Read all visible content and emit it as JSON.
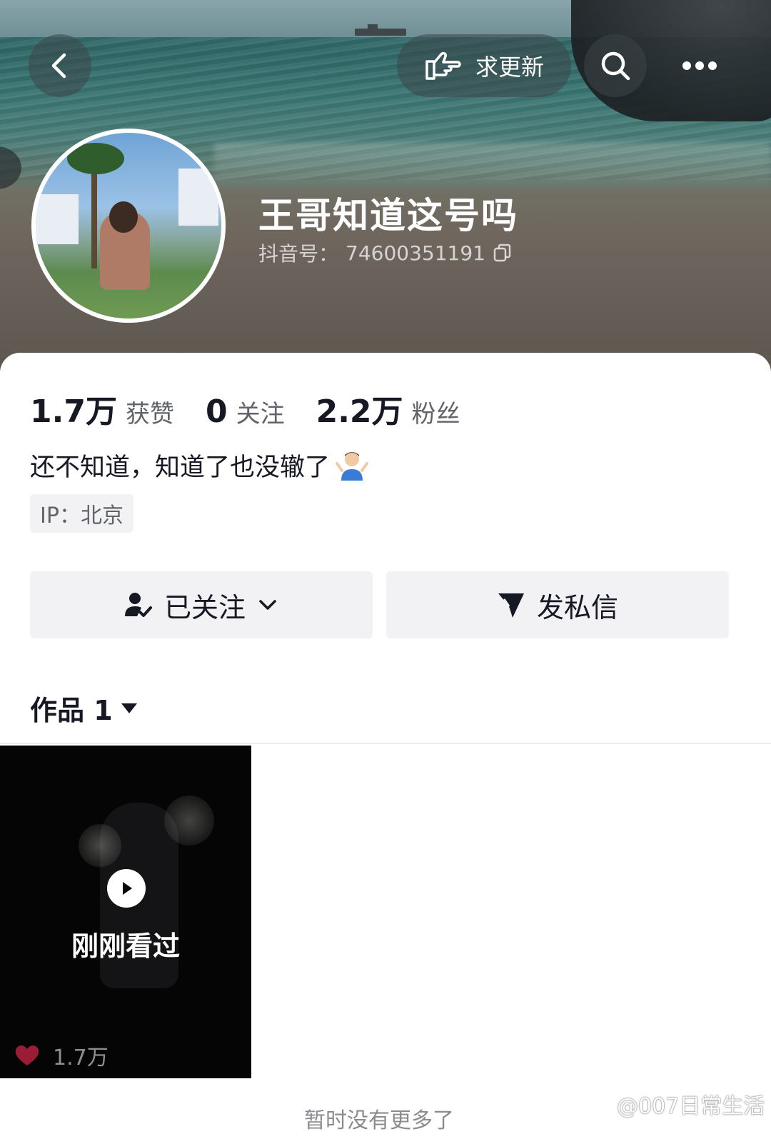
{
  "header": {
    "request_update_label": "求更新",
    "back_icon": "chevron-left-icon",
    "search_icon": "search-icon",
    "more_icon": "more-dots-icon"
  },
  "profile": {
    "username": "王哥知道这号吗",
    "douyin_id_label": "抖音号：",
    "douyin_id": "74600351191",
    "stats": [
      {
        "value": "1.7万",
        "label": "获赞"
      },
      {
        "value": "0",
        "label": "关注"
      },
      {
        "value": "2.2万",
        "label": "粉丝"
      }
    ],
    "bio": "还不知道，知道了也没辙了",
    "bio_emoji": "🤷‍♂️",
    "ip": "IP：北京"
  },
  "actions": {
    "followed_label": "已关注",
    "message_label": "发私信"
  },
  "works": {
    "tab_label": "作品 1",
    "items": [
      {
        "overlay_text": "刚刚看过",
        "likes": "1.7万"
      }
    ],
    "end_text": "暂时没有更多了"
  },
  "watermark": "@007日常生活",
  "colors": {
    "text_primary": "#161823",
    "text_secondary": "#61636b",
    "button_bg": "#f2f2f4",
    "like_red": "#fe2c55"
  }
}
